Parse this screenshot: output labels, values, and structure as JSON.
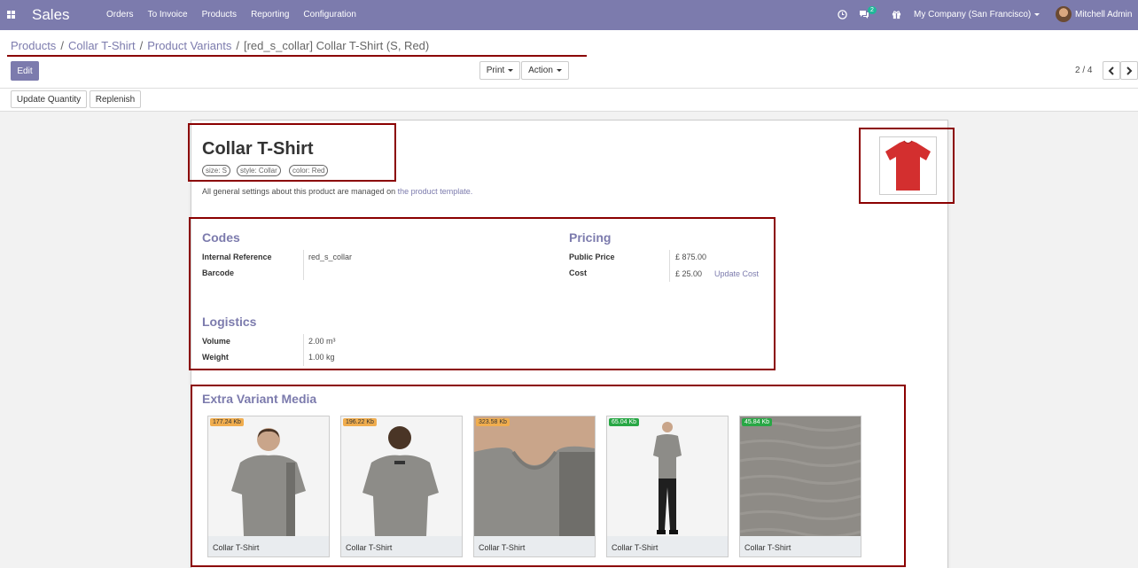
{
  "navbar": {
    "app_name": "Sales",
    "menu": [
      "Orders",
      "To Invoice",
      "Products",
      "Reporting",
      "Configuration"
    ],
    "chat_badge": "2",
    "company": "My Company (San Francisco)",
    "user": "Mitchell Admin"
  },
  "breadcrumb": {
    "items": [
      "Products",
      "Collar T-Shirt",
      "Product Variants"
    ],
    "current": "[red_s_collar] Collar T-Shirt (S, Red)"
  },
  "buttons": {
    "edit": "Edit",
    "print": "Print",
    "action": "Action",
    "update_quantity": "Update Quantity",
    "replenish": "Replenish"
  },
  "pager": {
    "value": "2 / 4"
  },
  "product": {
    "name": "Collar T-Shirt",
    "tags": [
      "size: S",
      "style: Collar",
      "color: Red"
    ],
    "note_text": "All general settings about this product are managed on",
    "note_link": "the product template."
  },
  "codes": {
    "title": "Codes",
    "internal_reference_label": "Internal Reference",
    "internal_reference": "red_s_collar",
    "barcode_label": "Barcode",
    "barcode": ""
  },
  "pricing": {
    "title": "Pricing",
    "public_price_label": "Public Price",
    "public_price": "£ 875.00",
    "cost_label": "Cost",
    "cost": "£ 25.00",
    "update_cost": "Update Cost"
  },
  "logistics": {
    "title": "Logistics",
    "volume_label": "Volume",
    "volume": "2.00 m³",
    "weight_label": "Weight",
    "weight": "1.00 kg"
  },
  "extra_media": {
    "title": "Extra Variant Media",
    "items": [
      {
        "caption": "Collar T-Shirt",
        "size": "177.24 Kb",
        "size_color": "#f0ad4e"
      },
      {
        "caption": "Collar T-Shirt",
        "size": "196.22 Kb",
        "size_color": "#f0ad4e"
      },
      {
        "caption": "Collar T-Shirt",
        "size": "323.58 Kb",
        "size_color": "#f0ad4e"
      },
      {
        "caption": "Collar T-Shirt",
        "size": "65.04 Kb",
        "size_color": "#28a745"
      },
      {
        "caption": "Collar T-Shirt",
        "size": "45.84 Kb",
        "size_color": "#28a745"
      }
    ]
  },
  "colors": {
    "navbar": "#7c7bad",
    "accent": "#7c7bad",
    "highlight_box": "#8b0000",
    "shirt": "#d32f2f"
  }
}
